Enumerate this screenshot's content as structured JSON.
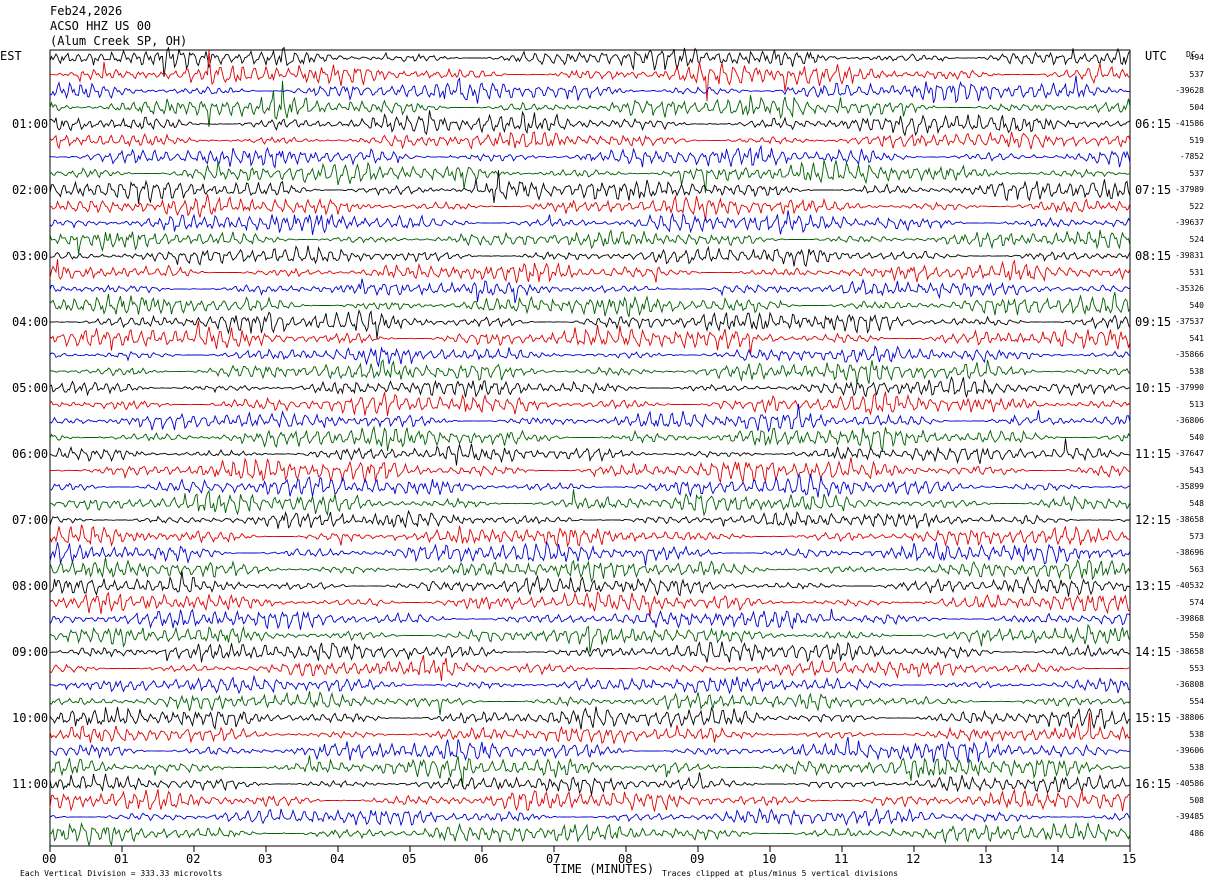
{
  "header": {
    "date": "Feb24,2026",
    "station": "ACSO HHZ US 00",
    "site": "(Alum Creek SP, OH)"
  },
  "left_axis_title": "EST",
  "right_axis_title": "UTC",
  "dc_label": "DC",
  "footer": {
    "scale_note": "Each Vertical Division =  333.33 microvolts",
    "clip_note": "Traces clipped at plus/minus 5 vertical divisions"
  },
  "colors": {
    "trace": [
      "#000000",
      "#e00000",
      "#0000d0",
      "#006000"
    ],
    "background": "#ffffff"
  },
  "chart_data": {
    "type": "line",
    "xlabel": "TIME (MINUTES)",
    "xlim": [
      0,
      15
    ],
    "x_ticks": [
      "00",
      "01",
      "02",
      "03",
      "04",
      "05",
      "06",
      "07",
      "08",
      "09",
      "10",
      "11",
      "12",
      "13",
      "14",
      "15"
    ],
    "rows": 48,
    "hour_labels_est": [
      "01:00",
      "02:00",
      "03:00",
      "04:00",
      "05:00",
      "06:00",
      "07:00",
      "08:00",
      "09:00",
      "10:00",
      "11:00"
    ],
    "hour_labels_utc": [
      "06:15",
      "07:15",
      "08:15",
      "09:15",
      "10:15",
      "11:15",
      "12:15",
      "13:15",
      "14:15",
      "15:15",
      "16:15"
    ],
    "dc_offsets": [
      "494",
      "537",
      "-39628",
      "504",
      "-41586",
      "519",
      "-7852",
      "537",
      "-37989",
      "522",
      "-39637",
      "524",
      "-39831",
      "531",
      "-35326",
      "540",
      "-37537",
      "541",
      "-35866",
      "538",
      "-37990",
      "513",
      "-36806",
      "540",
      "-37647",
      "543",
      "-35899",
      "548",
      "-38658",
      "573",
      "-38696",
      "563",
      "-40532",
      "574",
      "-39868",
      "550",
      "-38658",
      "553",
      "-36808",
      "554",
      "-38806",
      "538",
      "-39606",
      "538",
      "-40586",
      "508",
      "-39485",
      "486"
    ]
  }
}
